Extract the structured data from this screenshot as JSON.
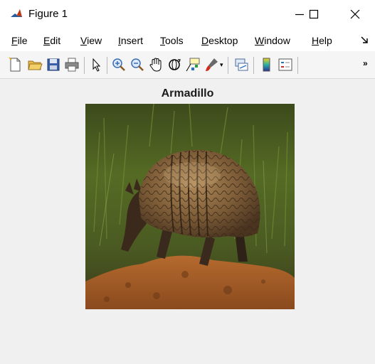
{
  "window": {
    "title": "Figure 1",
    "app_icon": "matlab-icon",
    "controls": [
      "minimize-icon",
      "maximize-icon",
      "close-icon"
    ]
  },
  "menu": {
    "items": [
      {
        "label": "File",
        "mnemonic": "F",
        "rest": "ile"
      },
      {
        "label": "Edit",
        "mnemonic": "E",
        "rest": "dit"
      },
      {
        "label": "View",
        "mnemonic": "V",
        "rest": "iew"
      },
      {
        "label": "Insert",
        "mnemonic": "I",
        "rest": "nsert"
      },
      {
        "label": "Tools",
        "mnemonic": "T",
        "rest": "ools"
      },
      {
        "label": "Desktop",
        "mnemonic": "D",
        "rest": "esktop"
      },
      {
        "label": "Window",
        "mnemonic": "W",
        "rest": "indow"
      },
      {
        "label": "Help",
        "mnemonic": "H",
        "rest": "elp"
      }
    ]
  },
  "toolbar": {
    "tools": [
      "new-figure-icon",
      "open-file-icon",
      "save-icon",
      "print-icon",
      "select-pointer-icon",
      "zoom-in-icon",
      "zoom-out-icon",
      "pan-hand-icon",
      "rotate-3d-icon",
      "data-cursor-icon",
      "brush-icon",
      "link-plot-icon",
      "colorbar-icon",
      "legend-icon"
    ],
    "overflow": "»"
  },
  "figure": {
    "axes_title": "Armadillo",
    "image_subject": "armadillo-photo"
  }
}
